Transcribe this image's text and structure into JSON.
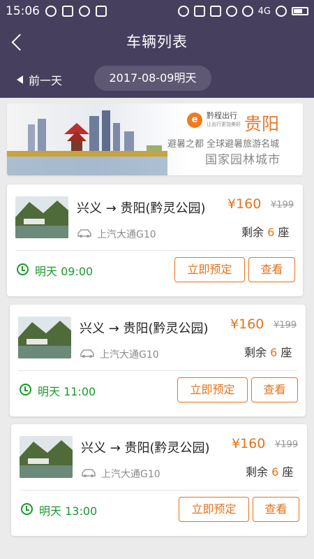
{
  "status_bar": {
    "time": "15:06",
    "network": "4G"
  },
  "header": {
    "title": "车辆列表",
    "prev_day_label": "前一天",
    "date_label": "2017-08-09明天"
  },
  "banner": {
    "brand_name": "黔程出行",
    "brand_slogan": "让出行更加美好",
    "city": "贵阳",
    "line1": "避暑之都  全球避暑旅游名城",
    "line2": "国家园林城市"
  },
  "theme": {
    "header_bg": "#463f5e",
    "accent": "#e5731b",
    "time_color": "#1a9a2b"
  },
  "trips": [
    {
      "route": "兴义 → 贵阳(黔灵公园)",
      "price": "¥160",
      "old_price": "¥199",
      "car_model": "上汽大通G10",
      "seats_label": "剩余",
      "seats_count": "6",
      "seats_unit": "座",
      "depart_time": "明天 09:00",
      "book_label": "立即预定",
      "view_label": "查看"
    },
    {
      "route": "兴义 → 贵阳(黔灵公园)",
      "price": "¥160",
      "old_price": "¥199",
      "car_model": "上汽大通G10",
      "seats_label": "剩余",
      "seats_count": "6",
      "seats_unit": "座",
      "depart_time": "明天 11:00",
      "book_label": "立即预定",
      "view_label": "查看"
    },
    {
      "route": "兴义 → 贵阳(黔灵公园)",
      "price": "¥160",
      "old_price": "¥199",
      "car_model": "上汽大通G10",
      "seats_label": "剩余",
      "seats_count": "6",
      "seats_unit": "座",
      "depart_time": "明天 13:00",
      "book_label": "立即预定",
      "view_label": "查看"
    }
  ]
}
